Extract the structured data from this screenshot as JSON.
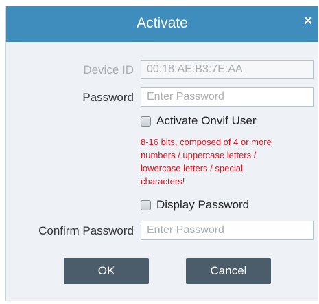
{
  "dialog": {
    "title": "Activate",
    "close_glyph": "×"
  },
  "device_id": {
    "label": "Device ID",
    "value": "00:18:AE:B3:7E:AA"
  },
  "password": {
    "label": "Password",
    "placeholder": "Enter Password"
  },
  "activate_onvif": {
    "label": "Activate Onvif User",
    "checked": false
  },
  "hint": "8-16 bits, composed of 4 or more numbers / uppercase letters / lowercase letters / special characters!",
  "display_password": {
    "label": "Display Password",
    "checked": false
  },
  "confirm_password": {
    "label": "Confirm Password",
    "placeholder": "Enter Password"
  },
  "buttons": {
    "ok": "OK",
    "cancel": "Cancel"
  },
  "colors": {
    "titlebar": "#3f8dbc",
    "button": "#4b5c6b",
    "hint": "#e8101a"
  },
  "icons": {
    "close": "close-icon"
  }
}
